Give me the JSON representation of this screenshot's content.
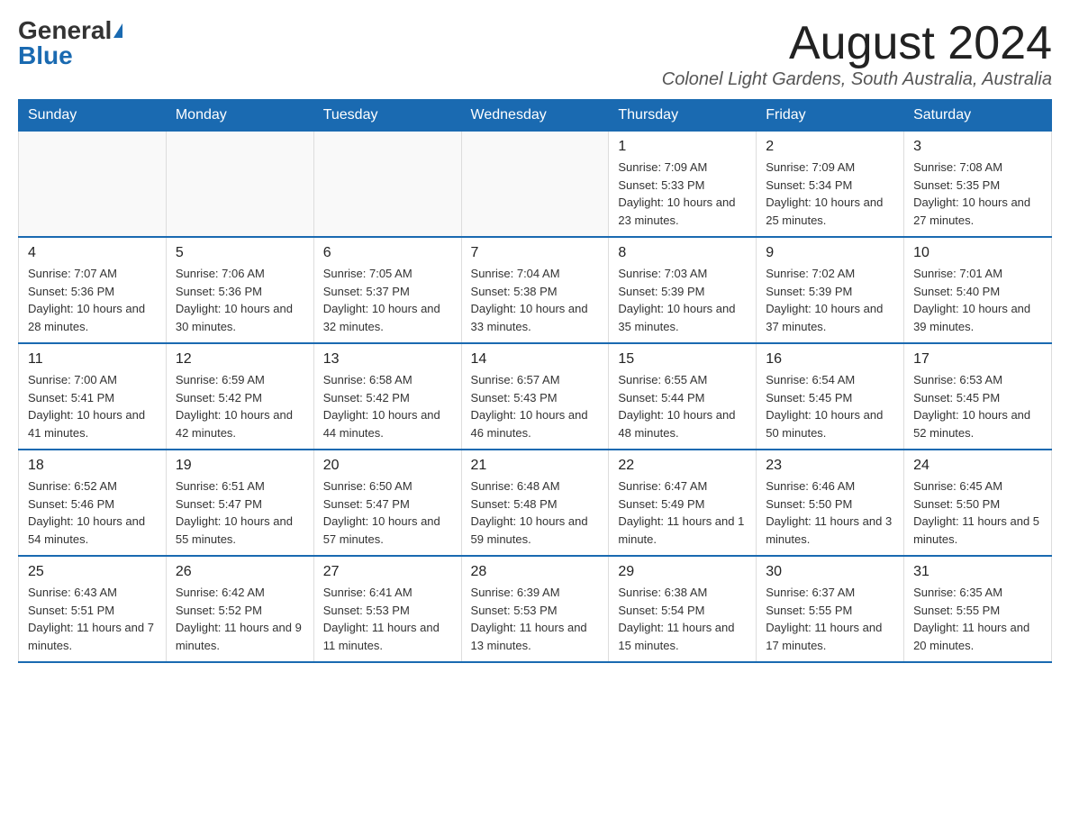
{
  "logo": {
    "general": "General",
    "blue": "Blue"
  },
  "header": {
    "month_year": "August 2024",
    "location": "Colonel Light Gardens, South Australia, Australia"
  },
  "days_of_week": [
    "Sunday",
    "Monday",
    "Tuesday",
    "Wednesday",
    "Thursday",
    "Friday",
    "Saturday"
  ],
  "weeks": [
    [
      {
        "day": "",
        "info": ""
      },
      {
        "day": "",
        "info": ""
      },
      {
        "day": "",
        "info": ""
      },
      {
        "day": "",
        "info": ""
      },
      {
        "day": "1",
        "info": "Sunrise: 7:09 AM\nSunset: 5:33 PM\nDaylight: 10 hours and 23 minutes."
      },
      {
        "day": "2",
        "info": "Sunrise: 7:09 AM\nSunset: 5:34 PM\nDaylight: 10 hours and 25 minutes."
      },
      {
        "day": "3",
        "info": "Sunrise: 7:08 AM\nSunset: 5:35 PM\nDaylight: 10 hours and 27 minutes."
      }
    ],
    [
      {
        "day": "4",
        "info": "Sunrise: 7:07 AM\nSunset: 5:36 PM\nDaylight: 10 hours and 28 minutes."
      },
      {
        "day": "5",
        "info": "Sunrise: 7:06 AM\nSunset: 5:36 PM\nDaylight: 10 hours and 30 minutes."
      },
      {
        "day": "6",
        "info": "Sunrise: 7:05 AM\nSunset: 5:37 PM\nDaylight: 10 hours and 32 minutes."
      },
      {
        "day": "7",
        "info": "Sunrise: 7:04 AM\nSunset: 5:38 PM\nDaylight: 10 hours and 33 minutes."
      },
      {
        "day": "8",
        "info": "Sunrise: 7:03 AM\nSunset: 5:39 PM\nDaylight: 10 hours and 35 minutes."
      },
      {
        "day": "9",
        "info": "Sunrise: 7:02 AM\nSunset: 5:39 PM\nDaylight: 10 hours and 37 minutes."
      },
      {
        "day": "10",
        "info": "Sunrise: 7:01 AM\nSunset: 5:40 PM\nDaylight: 10 hours and 39 minutes."
      }
    ],
    [
      {
        "day": "11",
        "info": "Sunrise: 7:00 AM\nSunset: 5:41 PM\nDaylight: 10 hours and 41 minutes."
      },
      {
        "day": "12",
        "info": "Sunrise: 6:59 AM\nSunset: 5:42 PM\nDaylight: 10 hours and 42 minutes."
      },
      {
        "day": "13",
        "info": "Sunrise: 6:58 AM\nSunset: 5:42 PM\nDaylight: 10 hours and 44 minutes."
      },
      {
        "day": "14",
        "info": "Sunrise: 6:57 AM\nSunset: 5:43 PM\nDaylight: 10 hours and 46 minutes."
      },
      {
        "day": "15",
        "info": "Sunrise: 6:55 AM\nSunset: 5:44 PM\nDaylight: 10 hours and 48 minutes."
      },
      {
        "day": "16",
        "info": "Sunrise: 6:54 AM\nSunset: 5:45 PM\nDaylight: 10 hours and 50 minutes."
      },
      {
        "day": "17",
        "info": "Sunrise: 6:53 AM\nSunset: 5:45 PM\nDaylight: 10 hours and 52 minutes."
      }
    ],
    [
      {
        "day": "18",
        "info": "Sunrise: 6:52 AM\nSunset: 5:46 PM\nDaylight: 10 hours and 54 minutes."
      },
      {
        "day": "19",
        "info": "Sunrise: 6:51 AM\nSunset: 5:47 PM\nDaylight: 10 hours and 55 minutes."
      },
      {
        "day": "20",
        "info": "Sunrise: 6:50 AM\nSunset: 5:47 PM\nDaylight: 10 hours and 57 minutes."
      },
      {
        "day": "21",
        "info": "Sunrise: 6:48 AM\nSunset: 5:48 PM\nDaylight: 10 hours and 59 minutes."
      },
      {
        "day": "22",
        "info": "Sunrise: 6:47 AM\nSunset: 5:49 PM\nDaylight: 11 hours and 1 minute."
      },
      {
        "day": "23",
        "info": "Sunrise: 6:46 AM\nSunset: 5:50 PM\nDaylight: 11 hours and 3 minutes."
      },
      {
        "day": "24",
        "info": "Sunrise: 6:45 AM\nSunset: 5:50 PM\nDaylight: 11 hours and 5 minutes."
      }
    ],
    [
      {
        "day": "25",
        "info": "Sunrise: 6:43 AM\nSunset: 5:51 PM\nDaylight: 11 hours and 7 minutes."
      },
      {
        "day": "26",
        "info": "Sunrise: 6:42 AM\nSunset: 5:52 PM\nDaylight: 11 hours and 9 minutes."
      },
      {
        "day": "27",
        "info": "Sunrise: 6:41 AM\nSunset: 5:53 PM\nDaylight: 11 hours and 11 minutes."
      },
      {
        "day": "28",
        "info": "Sunrise: 6:39 AM\nSunset: 5:53 PM\nDaylight: 11 hours and 13 minutes."
      },
      {
        "day": "29",
        "info": "Sunrise: 6:38 AM\nSunset: 5:54 PM\nDaylight: 11 hours and 15 minutes."
      },
      {
        "day": "30",
        "info": "Sunrise: 6:37 AM\nSunset: 5:55 PM\nDaylight: 11 hours and 17 minutes."
      },
      {
        "day": "31",
        "info": "Sunrise: 6:35 AM\nSunset: 5:55 PM\nDaylight: 11 hours and 20 minutes."
      }
    ]
  ]
}
